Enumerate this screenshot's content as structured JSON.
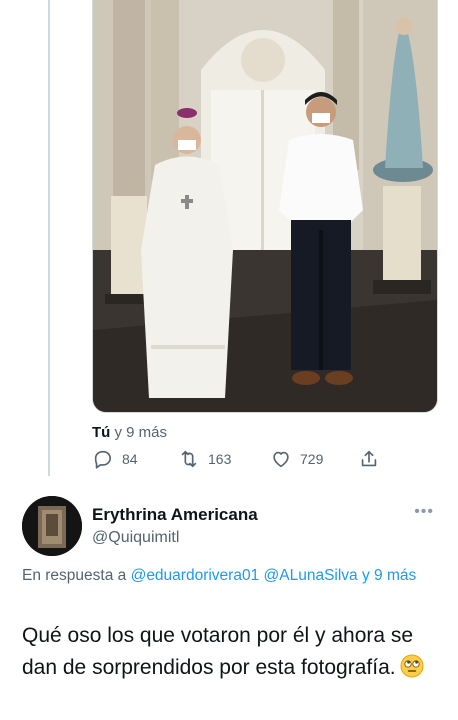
{
  "tweet": {
    "tagged_prefix": "Tú",
    "tagged_suffix": " y 9 más",
    "actions": {
      "replies": "84",
      "retweets": "163",
      "likes": "729"
    }
  },
  "reply": {
    "display_name": "Erythrina Americana",
    "handle": "@Quiquimitl",
    "more_label": "•••",
    "reply_prefix": "En respuesta a ",
    "mention_1": "@eduardorivera01",
    "mention_2": "@ALunaSilva",
    "mention_more": "y 9 más",
    "text": "Qué oso los que votaron por él y ahora se dan de sorprendidos por esta fotografía.",
    "emoji": "face-with-rolling-eyes"
  },
  "colors": {
    "accent": "#1d9bf0",
    "muted": "#536471",
    "text": "#0f1419"
  }
}
